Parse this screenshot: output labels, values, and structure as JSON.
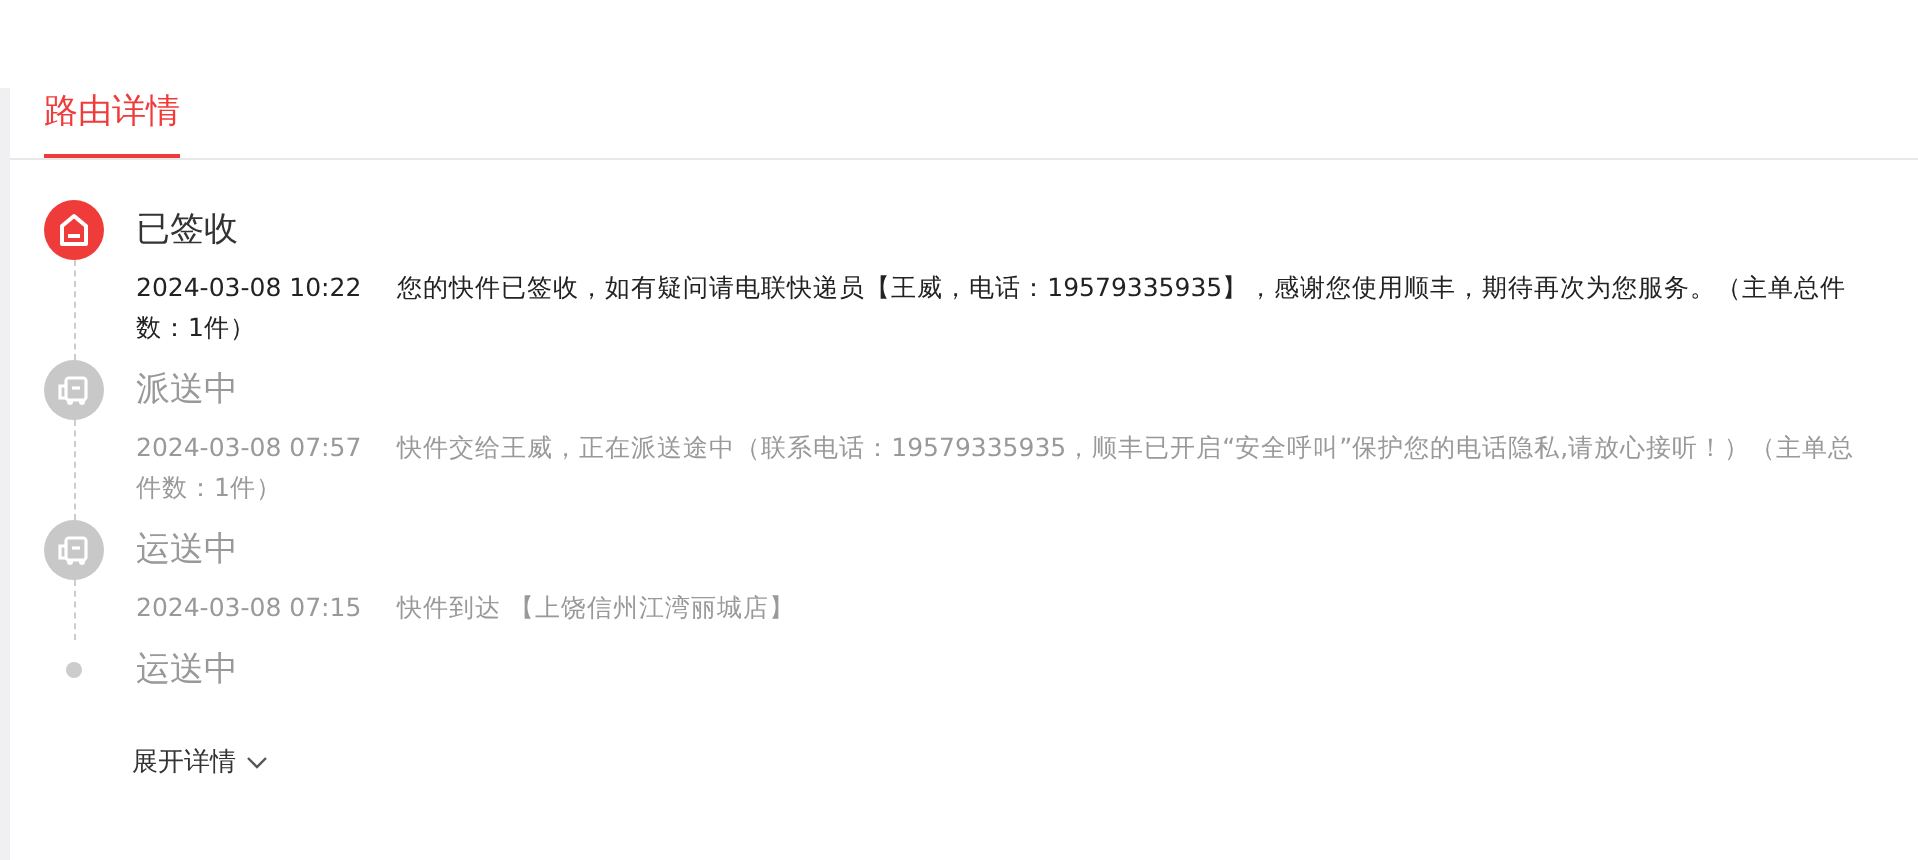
{
  "tabs": [
    {
      "label": "路由详情",
      "selected": true
    }
  ],
  "events": [
    {
      "kind": "signed",
      "current": true,
      "status": "已签收",
      "time": "2024-03-08 10:22",
      "text": "您的快件已签收，如有疑问请电联快递员【王威，电话：19579335935】，感谢您使用顺丰，期待再次为您服务。（主单总件数：1件）"
    },
    {
      "kind": "truck",
      "current": false,
      "status": "派送中",
      "time": "2024-03-08 07:57",
      "text": "快件交给王威，正在派送途中（联系电话：19579335935，顺丰已开启“安全呼叫”保护您的电话隐私,请放心接听！）（主单总件数：1件）"
    },
    {
      "kind": "truck",
      "current": false,
      "status": "运送中",
      "time": "2024-03-08 07:15",
      "text": "快件到达 【上饶信州江湾丽城店】"
    },
    {
      "kind": "dot",
      "current": false,
      "status": "运送中"
    }
  ],
  "expand": {
    "label": "展开详情"
  }
}
